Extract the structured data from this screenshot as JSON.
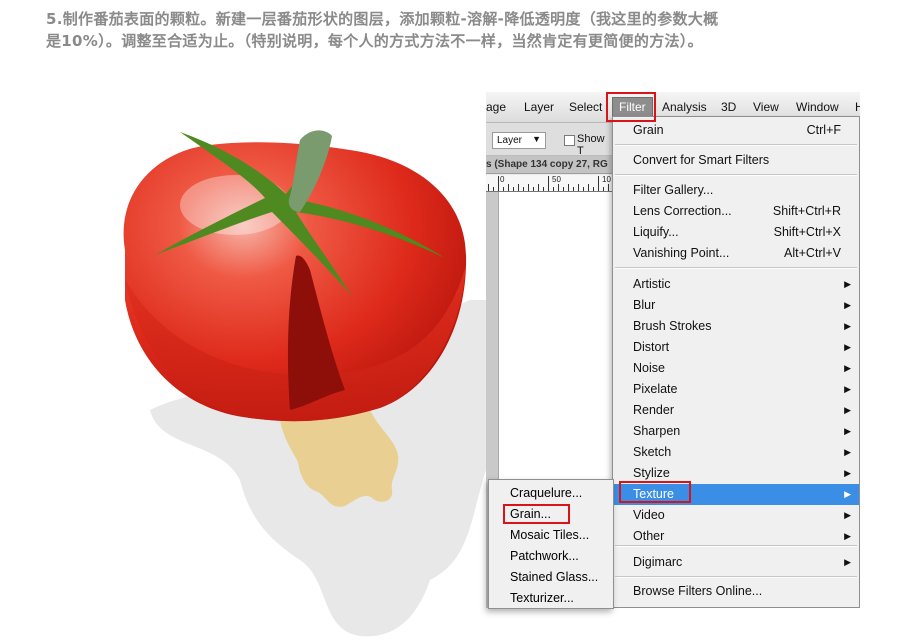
{
  "instruction": {
    "line1": "5.制作番茄表面的颗粒。新建一层番茄形状的图层，添加颗粒-溶解-降低透明度（我这里的参数大概",
    "line2": "是10%）。调整至合适为止。（特别说明，每个人的方式方法不一样，当然肯定有更简便的方法）。"
  },
  "menubar": {
    "items": [
      "age",
      "Layer",
      "Select",
      "Filter",
      "Analysis",
      "3D",
      "View",
      "Window",
      "H"
    ],
    "active": "Filter"
  },
  "options_bar": {
    "mode_select_value": "Layer",
    "checkbox_label": "Show T"
  },
  "document_tab": {
    "title": "s (Shape 134 copy 27, RG"
  },
  "ruler": {
    "labels": [
      "0",
      "50",
      "10"
    ]
  },
  "filter_menu": {
    "last_filter": {
      "label": "Grain",
      "shortcut": "Ctrl+F"
    },
    "convert": {
      "label": "Convert for Smart Filters"
    },
    "gallery_group": [
      {
        "label": "Filter Gallery...",
        "shortcut": ""
      },
      {
        "label": "Lens Correction...",
        "shortcut": "Shift+Ctrl+R"
      },
      {
        "label": "Liquify...",
        "shortcut": "Shift+Ctrl+X"
      },
      {
        "label": "Vanishing Point...",
        "shortcut": "Alt+Ctrl+V"
      }
    ],
    "categories": [
      "Artistic",
      "Blur",
      "Brush Strokes",
      "Distort",
      "Noise",
      "Pixelate",
      "Render",
      "Sharpen",
      "Sketch",
      "Stylize",
      "Texture",
      "Video",
      "Other"
    ],
    "highlighted": "Texture",
    "plugins": [
      "Digimarc"
    ],
    "online": "Browse Filters Online..."
  },
  "texture_submenu": {
    "items": [
      "Craquelure...",
      "Grain...",
      "Mosaic Tiles...",
      "Patchwork...",
      "Stained Glass...",
      "Texturizer..."
    ],
    "boxed": "Grain..."
  },
  "colors": {
    "annotation_red": "#d8141a",
    "menu_highlight": "#3a8ee6",
    "tomato_red": "#e0261c",
    "stem_green": "#4e8a1f",
    "shadow_gray": "#e6e6e6"
  },
  "icons": {
    "submenu_arrow": "chevron-right-icon",
    "dropdown_arrow": "chevron-down-icon"
  }
}
